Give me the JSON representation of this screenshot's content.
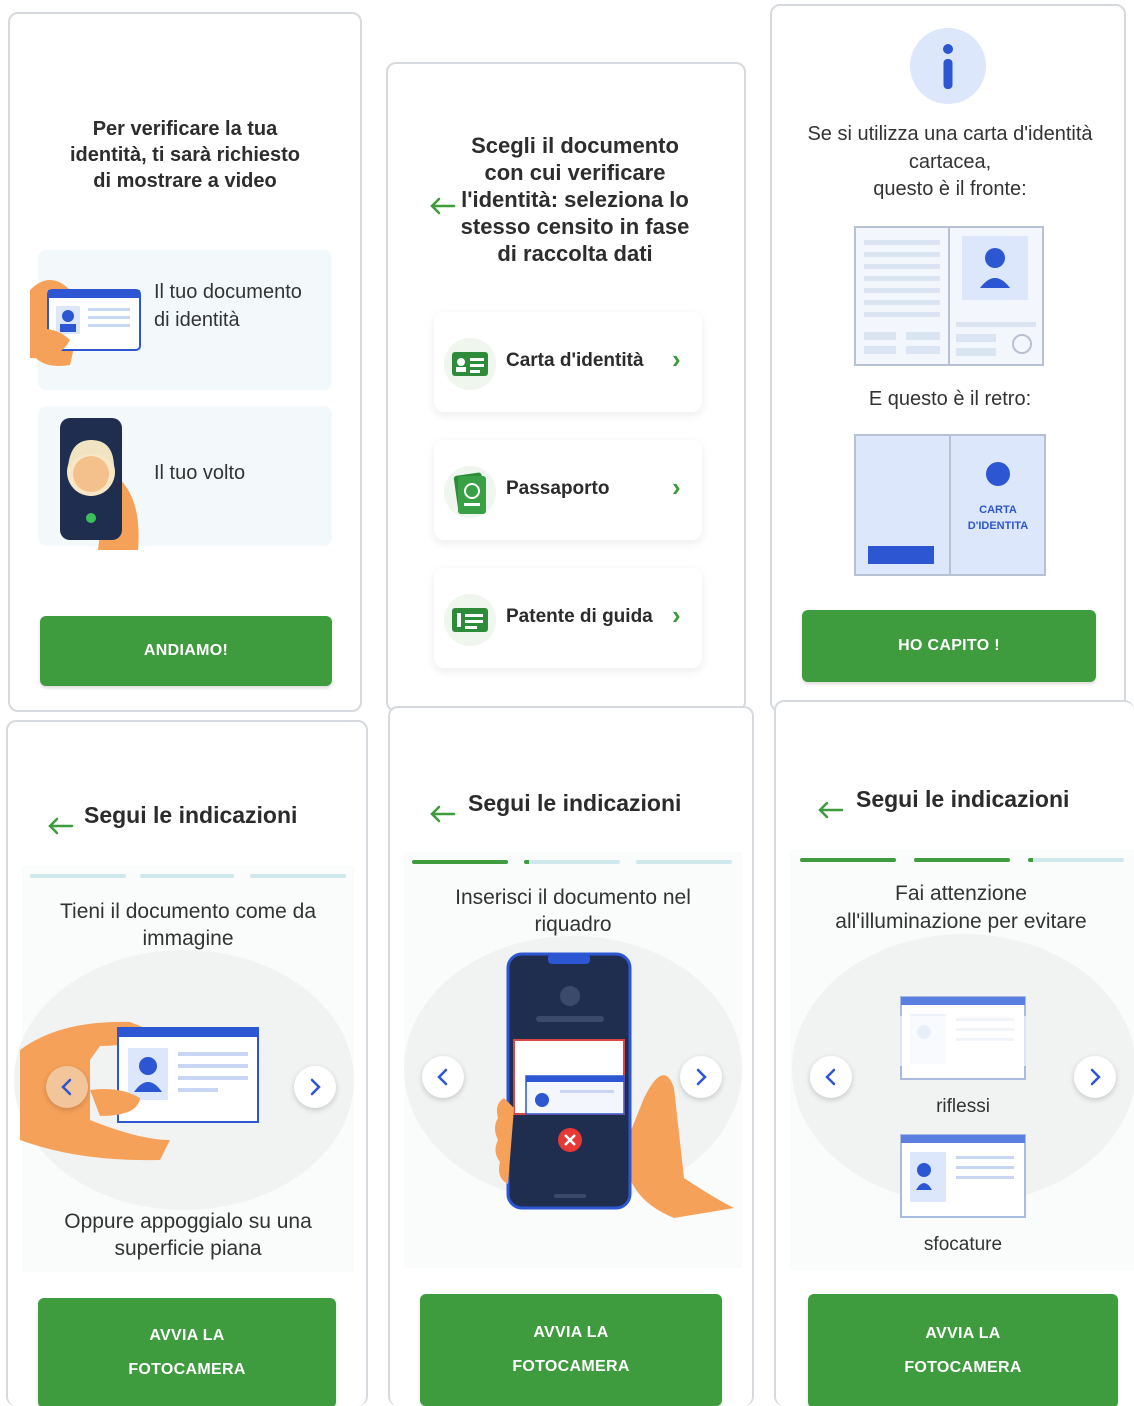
{
  "colors": {
    "green": "#3e9b3e",
    "blue": "#2c56d2",
    "light_blue": "#dde7fb",
    "skin": "#f6a15a"
  },
  "screen1": {
    "title": "Per verificare la tua identità, ti sarà richiesto di mostrare a video",
    "item_document": "Il tuo documento di identità",
    "item_face": "Il tuo volto",
    "button": "ANDIAMO!"
  },
  "screen2": {
    "title": "Scegli il documento con cui verificare l'identità: seleziona lo stesso censito in fase di raccolta dati",
    "options": [
      {
        "label": "Carta d'identità",
        "icon": "id-card-icon"
      },
      {
        "label": "Passaporto",
        "icon": "passport-icon"
      },
      {
        "label": "Patente di guida",
        "icon": "driving-license-icon"
      }
    ]
  },
  "screen3": {
    "text": "Se si utilizza una carta d'identità cartacea,",
    "text2": "questo è il fronte:",
    "back_text": "E questo è il retro:",
    "card_label_1": "CARTA",
    "card_label_2": "D'IDENTITA",
    "button": "HO CAPITO !"
  },
  "screen4": {
    "header": "Segui le indicazioni",
    "instruction": "Tieni il documento come da immagine",
    "bottom_text": "Oppure appoggialo su una superficie piana",
    "button_line1": "AVVIA LA",
    "button_line2": "FOTOCAMERA"
  },
  "screen5": {
    "header": "Segui le indicazioni",
    "instruction": "Inserisci il documento nel riquadro",
    "button_line1": "AVVIA LA",
    "button_line2": "FOTOCAMERA"
  },
  "screen6": {
    "header": "Segui le indicazioni",
    "instruction": "Fai attenzione all'illuminazione per evitare",
    "label_reflections": "riflessi",
    "label_blur": "sfocature",
    "button_line1": "AVVIA LA",
    "button_line2": "FOTOCAMERA"
  }
}
